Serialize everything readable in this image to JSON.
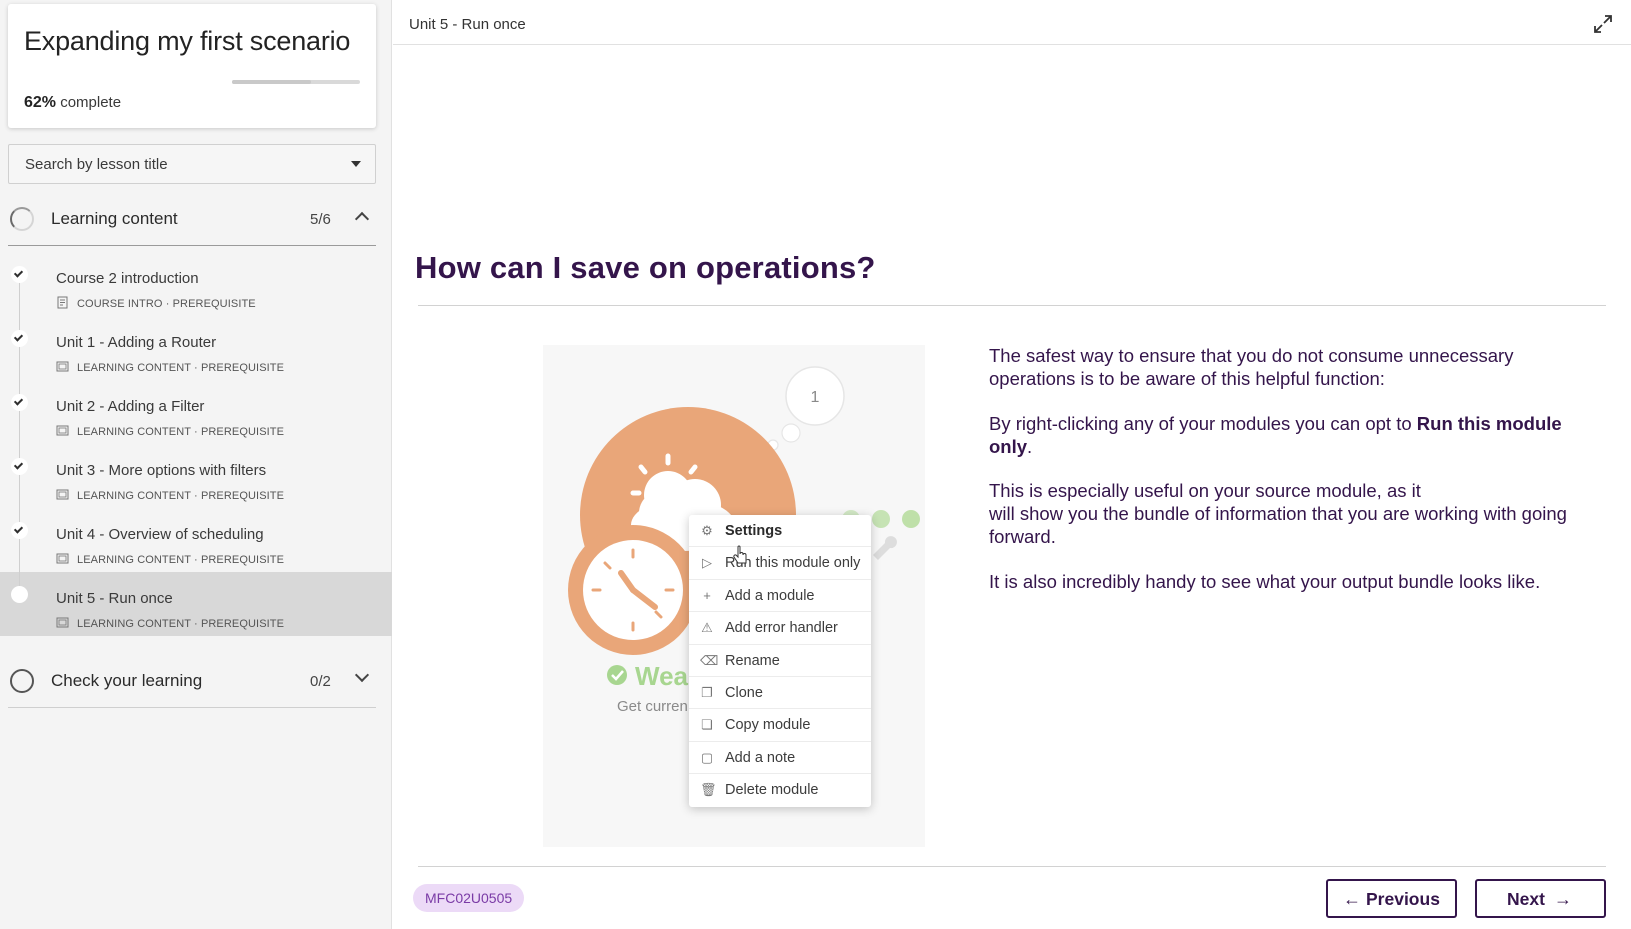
{
  "course": {
    "title": "Expanding my first scenario",
    "progress_percent": 62,
    "progress_value": "62%",
    "progress_suffix": "complete"
  },
  "search": {
    "placeholder": "Search by lesson title"
  },
  "sections": [
    {
      "label": "Learning content",
      "count": "5/6",
      "expanded": true,
      "lessons": [
        {
          "title": "Course 2 introduction",
          "type": "COURSE INTRO",
          "tag": "PREREQUISITE",
          "completed": true,
          "active": false
        },
        {
          "title": "Unit 1 - Adding a Router",
          "type": "LEARNING CONTENT",
          "tag": "PREREQUISITE",
          "completed": true,
          "active": false
        },
        {
          "title": "Unit 2 - Adding a Filter",
          "type": "LEARNING CONTENT",
          "tag": "PREREQUISITE",
          "completed": true,
          "active": false
        },
        {
          "title": "Unit 3 - More options with filters",
          "type": "LEARNING CONTENT",
          "tag": "PREREQUISITE",
          "completed": true,
          "active": false
        },
        {
          "title": "Unit 4 - Overview of scheduling",
          "type": "LEARNING CONTENT",
          "tag": "PREREQUISITE",
          "completed": true,
          "active": false
        },
        {
          "title": "Unit 5 - Run once",
          "type": "LEARNING CONTENT",
          "tag": "PREREQUISITE",
          "completed": false,
          "active": true
        }
      ]
    },
    {
      "label": "Check your learning",
      "count": "0/2",
      "expanded": false
    }
  ],
  "meta_separator": "·",
  "main": {
    "unit_title": "Unit 5 - Run once",
    "heading": "How can I save on operations?",
    "paragraphs": [
      {
        "text": "The safest way to ensure that you do not consume unnecessary operations is to be aware of this helpful function:"
      },
      {
        "before": "By right-clicking any of your modules you can opt to ",
        "bold": "Run this module only",
        "after": "."
      },
      {
        "line1": "This is especially useful on your source module, as it",
        "line2": "will show you the bundle of information that you are working with going forward."
      },
      {
        "text": "It is also incredibly handy to see what your output bundle looks like."
      }
    ],
    "illustration": {
      "bubble_number": "1",
      "module_name_partial": "Wea",
      "module_sub_partial": "Get curren",
      "menu_items": [
        {
          "label": "Settings",
          "icon": "gear-icon",
          "glyph": "⚙",
          "bold": true
        },
        {
          "label": "Run this module only",
          "icon": "play-icon",
          "glyph": "▷",
          "bold": false
        },
        {
          "label": "Add a module",
          "icon": "plus-icon",
          "glyph": "+",
          "bold": false
        },
        {
          "label": "Add error handler",
          "icon": "warning-icon",
          "glyph": "⚠",
          "bold": false
        },
        {
          "label": "Rename",
          "icon": "eraser-icon",
          "glyph": "⌫",
          "bold": false
        },
        {
          "label": "Clone",
          "icon": "clone-icon",
          "glyph": "❐",
          "bold": false
        },
        {
          "label": "Copy module",
          "icon": "copy-icon",
          "glyph": "❏",
          "bold": false
        },
        {
          "label": "Add a note",
          "icon": "note-icon",
          "glyph": "▢",
          "bold": false
        },
        {
          "label": "Delete module",
          "icon": "trash-icon",
          "glyph": "🗑",
          "bold": false
        }
      ]
    },
    "code": "MFC02U0505",
    "prev_label": "Previous",
    "next_label": "Next"
  },
  "colors": {
    "heading": "#34154b",
    "badge_bg": "#ecdaf7",
    "badge_text": "#7a3ba6",
    "illustration_orange": "#e9a679",
    "illustration_green": "#a8d690"
  }
}
